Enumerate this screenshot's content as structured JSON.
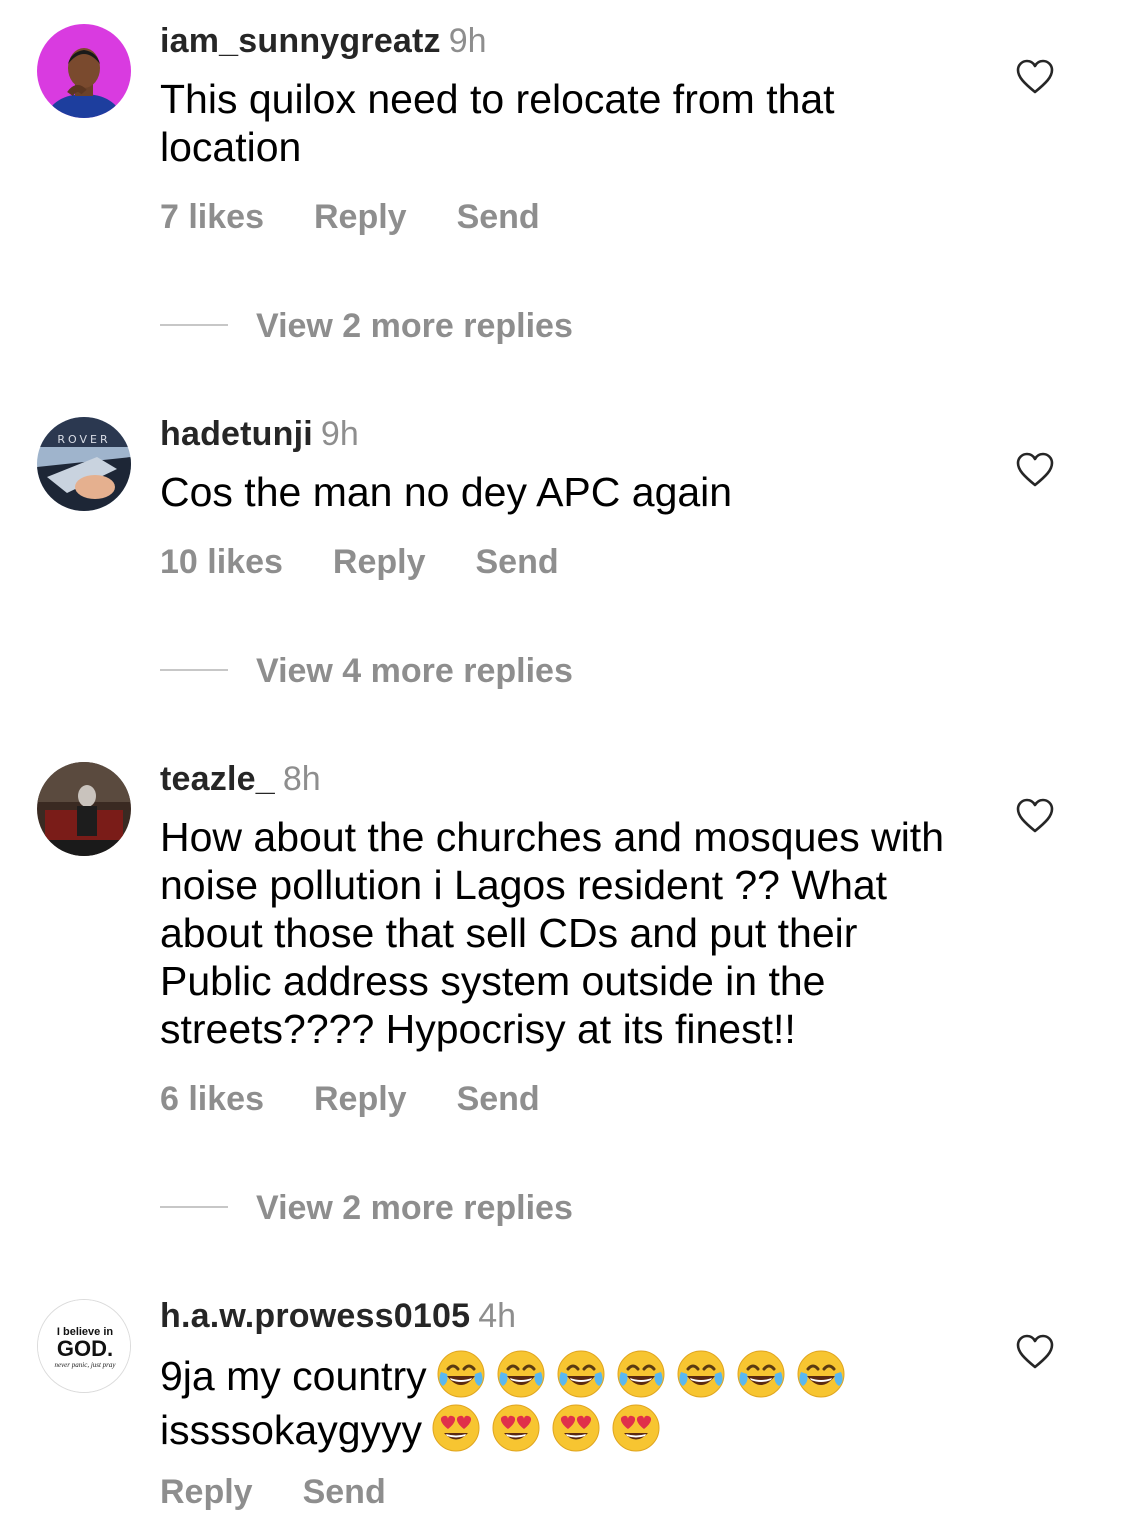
{
  "comments": [
    {
      "username": "iam_sunnygreatz",
      "time": "9h",
      "text": "This quilox need to relocate from that location",
      "likes": "7 likes",
      "reply": "Reply",
      "send": "Send",
      "more_replies": "View 2 more replies"
    },
    {
      "username": "hadetunji",
      "time": "9h",
      "text": "Cos the man no dey APC again",
      "likes": "10 likes",
      "reply": "Reply",
      "send": "Send",
      "more_replies": "View 4 more replies",
      "avatar_text": "ROVER"
    },
    {
      "username": "teazle_",
      "time": "8h",
      "text": "How about the churches and mosques with noise pollution i Lagos resident ?? What about those that sell CDs and put their Public address system outside in the streets???? Hypocrisy at its finest!!",
      "likes": "6 likes",
      "reply": "Reply",
      "send": "Send",
      "more_replies": "View 2 more replies"
    },
    {
      "username": "h.a.w.prowess0105",
      "time": "4h",
      "text_line1": "9ja my country",
      "text_line2": "issssokaygyyy",
      "reply": "Reply",
      "send": "Send",
      "avatar_line1": "I believe in",
      "avatar_line2": "GOD.",
      "avatar_line3": "never panic, just pray",
      "emoji_line1": [
        "tears-of-joy",
        "tears-of-joy",
        "tears-of-joy",
        "tears-of-joy",
        "tears-of-joy",
        "tears-of-joy",
        "tears-of-joy"
      ],
      "emoji_line2": [
        "heart-eyes",
        "heart-eyes",
        "heart-eyes",
        "heart-eyes"
      ]
    }
  ],
  "colors": {
    "username": "#262626",
    "meta": "#8e8e8e",
    "avatar1_bg": "#d93be0",
    "emoji_yellow": "#f7c531"
  },
  "icons": {
    "like": "heart-outline-icon"
  }
}
